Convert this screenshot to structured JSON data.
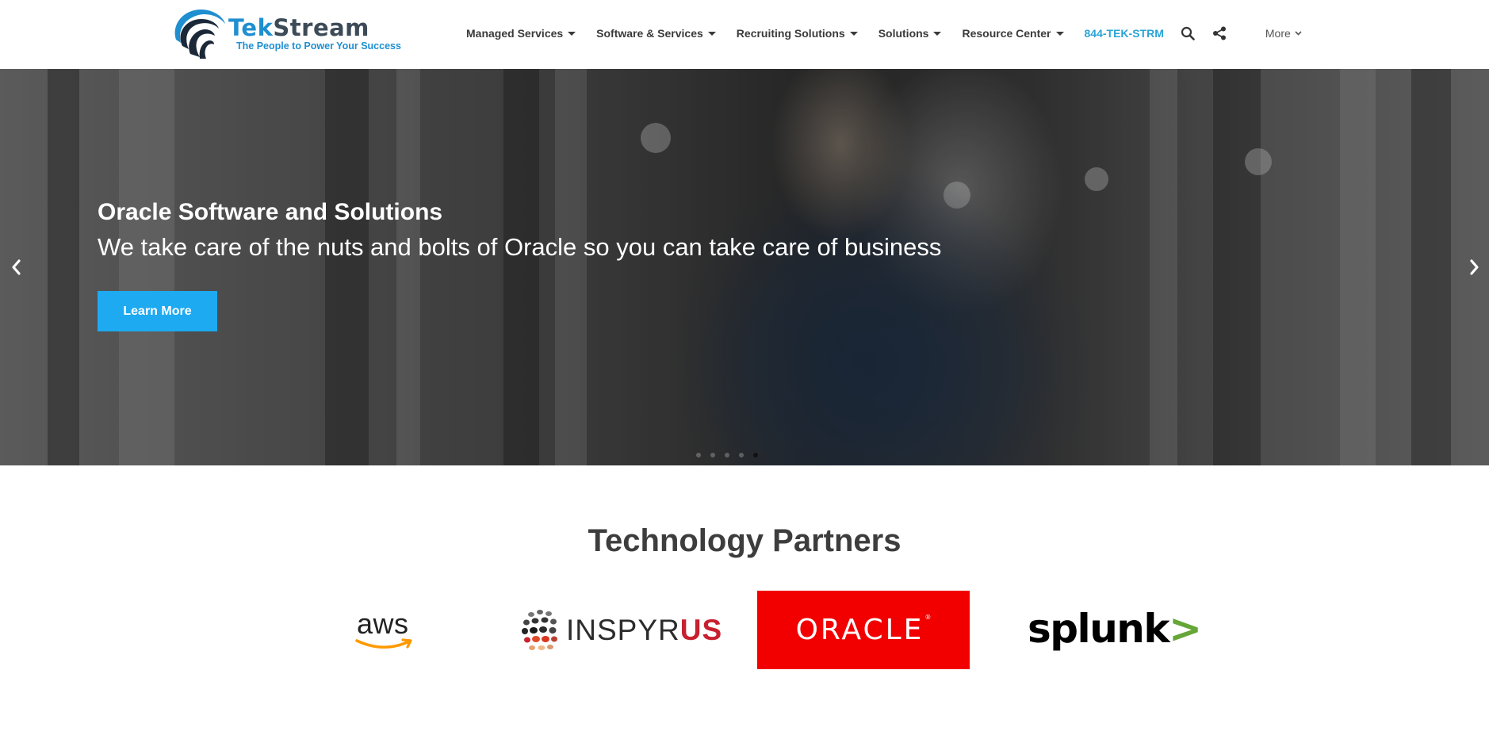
{
  "header": {
    "logo": {
      "brand": "TekStream",
      "brand_prefix": "Tek",
      "brand_suffix": "Stream",
      "tagline": "The People to Power Your Success"
    },
    "nav": [
      {
        "label": "Managed Services",
        "has_dropdown": true
      },
      {
        "label": "Software & Services",
        "has_dropdown": true
      },
      {
        "label": "Recruiting Solutions",
        "has_dropdown": true
      },
      {
        "label": "Solutions",
        "has_dropdown": true
      },
      {
        "label": "Resource Center",
        "has_dropdown": true
      }
    ],
    "phone": "844-TEK-STRM",
    "search_icon": "search-icon",
    "share_icon": "share-icon",
    "more_label": "More"
  },
  "hero": {
    "title": "Oracle Software and Solutions",
    "subtitle": "We take care of the nuts and bolts of Oracle so you can take care of business",
    "button_label": "Learn More",
    "prev_icon": "chevron-left-icon",
    "next_icon": "chevron-right-icon",
    "slide_count": 5,
    "active_slide": 5
  },
  "partners": {
    "title": "Technology Partners",
    "logos": [
      {
        "name": "aws",
        "text": "aws"
      },
      {
        "name": "inspyrus",
        "text_main": "INSPYR",
        "text_accent": "US"
      },
      {
        "name": "oracle",
        "text": "ORACLE"
      },
      {
        "name": "splunk",
        "text_main": "splunk",
        "text_accent": ">"
      }
    ]
  },
  "colors": {
    "accent": "#1eaaf1",
    "phone": "#2aa4d8",
    "brand_blue": "#1f8fd0",
    "brand_dark": "#3d4a57",
    "oracle_red": "#f20000",
    "inspyrus_red": "#c8202f",
    "splunk_green": "#65a637",
    "aws_orange": "#f90"
  }
}
